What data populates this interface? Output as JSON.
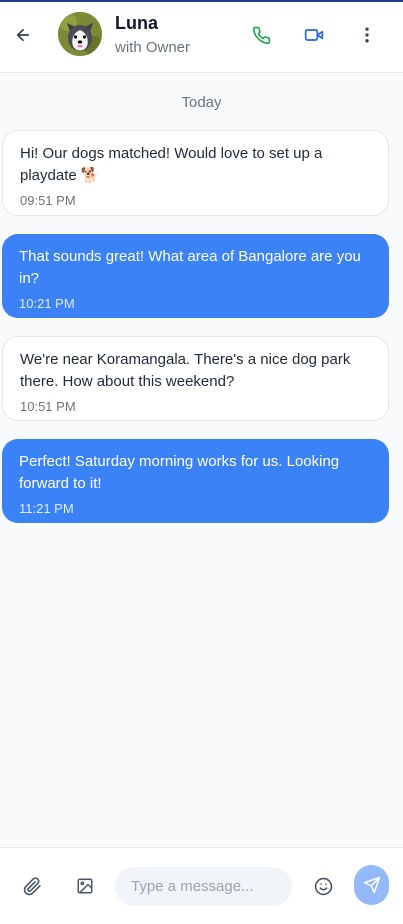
{
  "header": {
    "title": "Luna",
    "subtitle": "with Owner",
    "back_icon": "arrow-left-icon",
    "phone_icon": "phone-icon",
    "video_icon": "video-icon",
    "more_icon": "more-vertical-icon"
  },
  "chat": {
    "date_separator": "Today",
    "messages": [
      {
        "direction": "incoming",
        "text": "Hi! Our dogs matched! Would love to set up a playdate 🐕",
        "time": "09:51 PM"
      },
      {
        "direction": "outgoing",
        "text": "That sounds great! What area of Bangalore are you in?",
        "time": "10:21 PM"
      },
      {
        "direction": "incoming",
        "text": "We're near Koramangala. There's a nice dog park there. How about this weekend?",
        "time": "10:51 PM"
      },
      {
        "direction": "outgoing",
        "text": "Perfect! Saturday morning works for us. Looking forward to it!",
        "time": "11:21 PM"
      }
    ]
  },
  "composer": {
    "placeholder": "Type a message...",
    "value": "",
    "attach_icon": "paperclip-icon",
    "image_icon": "image-icon",
    "emoji_icon": "smile-icon",
    "send_icon": "send-icon"
  },
  "colors": {
    "accent": "#3b82f6",
    "phone_green": "#16a34a",
    "video_blue": "#2563eb",
    "send_disabled": "#93b9f8"
  }
}
